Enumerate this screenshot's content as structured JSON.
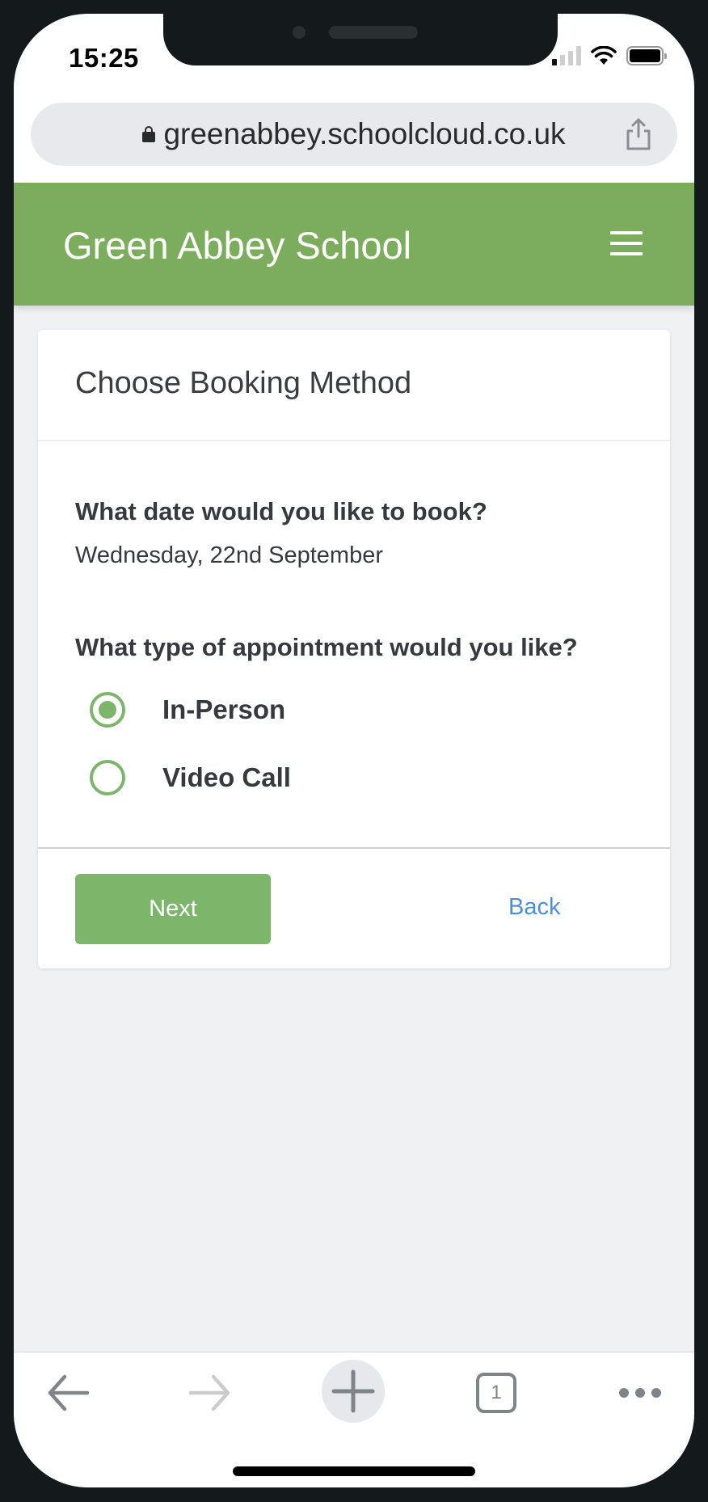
{
  "status_bar": {
    "time": "15:25",
    "signal_icon": "signal-icon",
    "wifi_icon": "wifi-icon",
    "battery_icon": "battery-icon"
  },
  "browser": {
    "url": "greenabbey.schoolcloud.co.uk",
    "lock_icon": "lock-icon",
    "share_icon": "share-icon",
    "toolbar": {
      "back_icon": "arrow-left-icon",
      "forward_icon": "arrow-right-icon",
      "new_tab_icon": "plus-icon",
      "tab_count": "1",
      "more_icon": "more-dots-icon"
    }
  },
  "header": {
    "title": "Green Abbey School",
    "menu_icon": "hamburger-icon",
    "color": "#7cad5d"
  },
  "card": {
    "title": "Choose Booking Method",
    "date_question": "What date would you like to book?",
    "date_value": "Wednesday, 22nd September",
    "type_question": "What type of appointment would you like?",
    "options": [
      {
        "label": "In-Person",
        "selected": true
      },
      {
        "label": "Video Call",
        "selected": false
      }
    ],
    "next_label": "Next",
    "back_label": "Back",
    "accent_color": "#7cb66a",
    "link_color": "#4a90d9"
  }
}
